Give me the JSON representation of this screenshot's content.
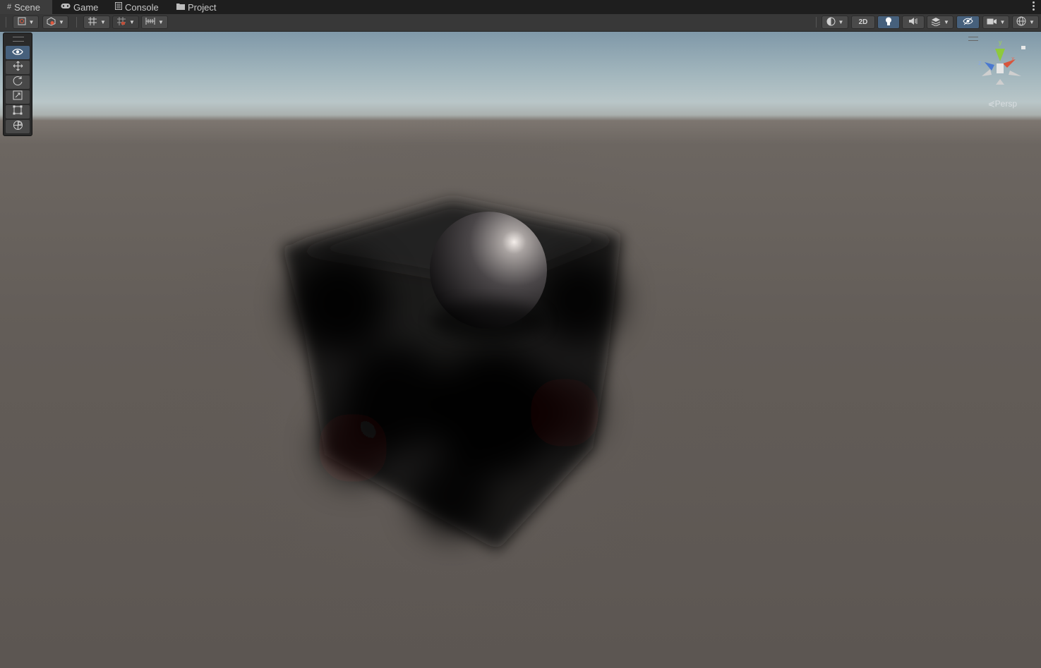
{
  "tabs": [
    {
      "label": "Scene",
      "icon": "grid-icon",
      "active": true
    },
    {
      "label": "Game",
      "icon": "gamepad-icon",
      "active": false
    },
    {
      "label": "Console",
      "icon": "console-icon",
      "active": false
    },
    {
      "label": "Project",
      "icon": "folder-icon",
      "active": false
    }
  ],
  "toolbar": {
    "left": [
      "draw-mode-icon",
      "orientation-cube-icon",
      "grid-snap-icon",
      "increment-snap-icon",
      "ruler-icon"
    ],
    "right": {
      "shading_icon": "shading-sphere-icon",
      "mode_2d_label": "2D",
      "lighting_icon": "lightbulb-icon",
      "audio_icon": "audio-icon",
      "effects_icon": "effects-layers-icon",
      "visibility_icon": "scene-visibility-icon",
      "camera_icon": "camera-icon",
      "gizmos_icon": "gizmos-globe-icon"
    }
  },
  "tools": [
    "view-tool-icon",
    "move-tool-icon",
    "rotate-tool-icon",
    "scale-tool-icon",
    "rect-tool-icon",
    "transform-tool-icon"
  ],
  "gizmo": {
    "axis_y": "y",
    "axis_x": "x",
    "axis_z": "z",
    "projection_label": "Persp"
  },
  "colors": {
    "accent": "#46607c",
    "axis_x": "#d8553c",
    "axis_y": "#8ec93c",
    "axis_z": "#4a78d0"
  }
}
